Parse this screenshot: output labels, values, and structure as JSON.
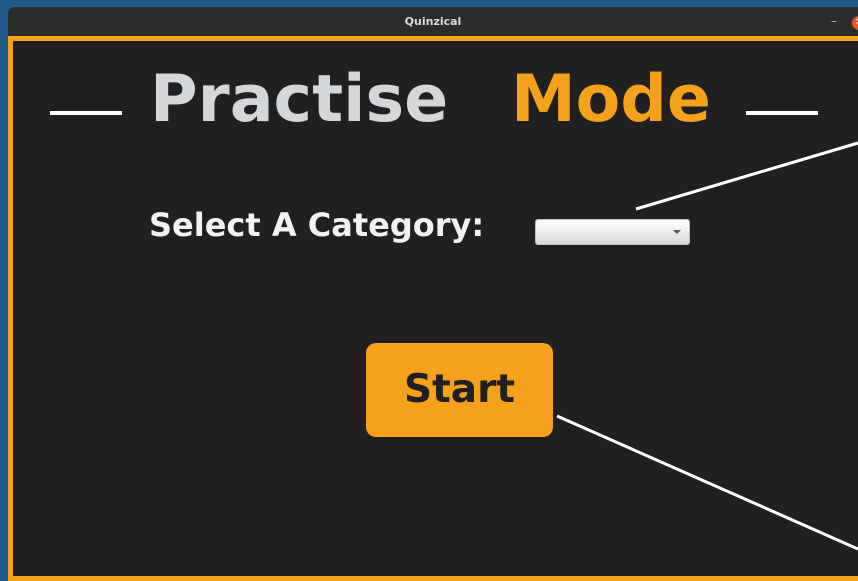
{
  "window": {
    "title": "Quinzical",
    "minimize_glyph": "–",
    "close_glyph": "✕"
  },
  "page": {
    "dash_glyph": "—",
    "title_part1": "Practise",
    "title_part2": "Mode",
    "category_label": "Select A Category:",
    "category_select_value": "",
    "start_button_label": "Start"
  },
  "colors": {
    "accent": "#f5a11c",
    "background": "#202020",
    "title_grey": "#d3d7d9",
    "titlebar": "#2c2c2c",
    "close_button": "#e95420"
  },
  "icons": {
    "select_arrow": "chevron-down-icon"
  }
}
